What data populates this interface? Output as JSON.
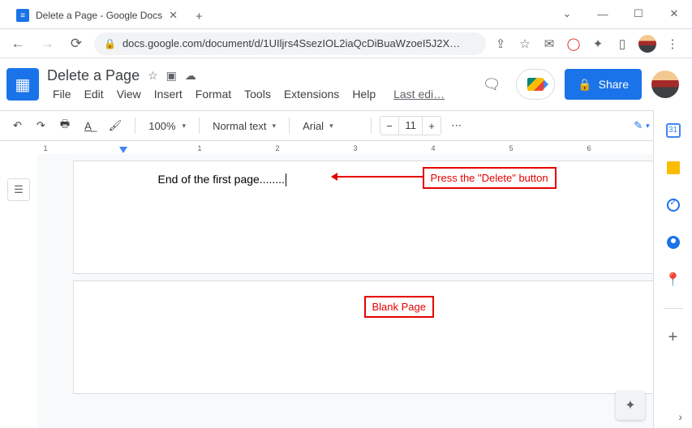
{
  "browser": {
    "tab_title": "Delete a Page - Google Docs",
    "url": "docs.google.com/document/d/1UIljrs4SsezIOL2iaQcDiBuaWzoeI5J2X…"
  },
  "docs": {
    "title": "Delete a Page",
    "menus": {
      "file": "File",
      "edit": "Edit",
      "view": "View",
      "insert": "Insert",
      "format": "Format",
      "tools": "Tools",
      "extensions": "Extensions",
      "help": "Help",
      "lastedit": "Last edi…"
    },
    "share": "Share"
  },
  "toolbar": {
    "zoom": "100%",
    "style": "Normal text",
    "font": "Arial",
    "size": "11"
  },
  "document": {
    "line": "End of the first page........"
  },
  "annotations": {
    "press_delete": "Press the \"Delete\" button",
    "blank_page": "Blank Page"
  },
  "sidepanel": {
    "cal": "31"
  }
}
